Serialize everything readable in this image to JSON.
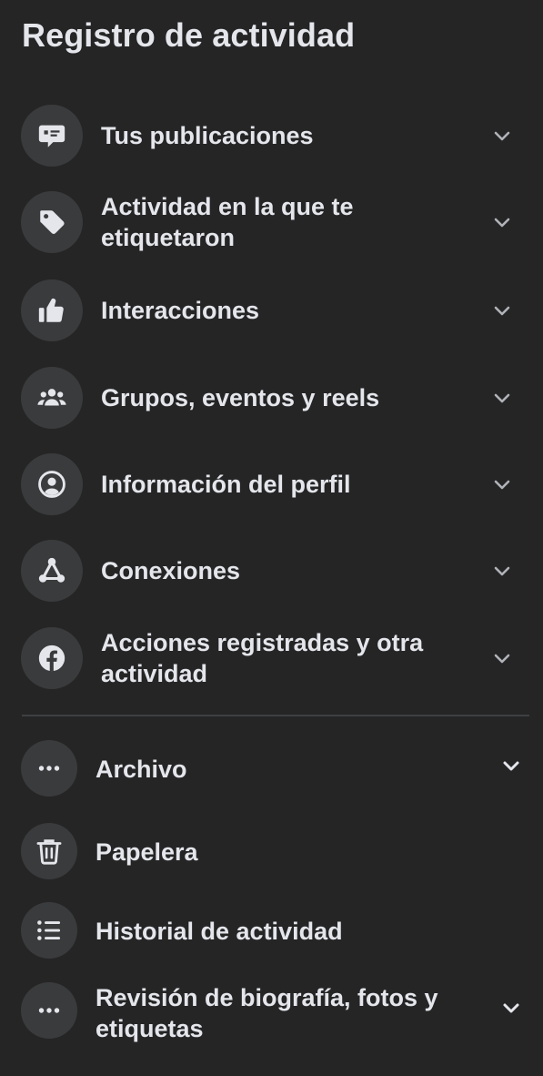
{
  "header": {
    "title": "Registro de actividad"
  },
  "sections": [
    {
      "label": "Tus publicaciones",
      "icon": "speech-bubble-icon"
    },
    {
      "label": "Actividad en la que te etiquetaron",
      "icon": "tag-icon"
    },
    {
      "label": "Interacciones",
      "icon": "thumbs-up-icon"
    },
    {
      "label": "Grupos, eventos y reels",
      "icon": "group-icon"
    },
    {
      "label": "Información del perfil",
      "icon": "profile-icon"
    },
    {
      "label": "Conexiones",
      "icon": "network-icon"
    },
    {
      "label": "Acciones registradas y otra actividad",
      "icon": "facebook-icon"
    }
  ],
  "tools": [
    {
      "label": "Archivo",
      "icon": "more-icon"
    },
    {
      "label": "Papelera",
      "icon": "trash-icon"
    },
    {
      "label": "Historial de actividad",
      "icon": "list-icon"
    },
    {
      "label": "Revisión de biografía, fotos y etiquetas",
      "icon": "more-icon"
    }
  ],
  "colors": {
    "background": "#252526",
    "icon_circle": "#3a3b3c",
    "text": "#e4e6eb",
    "divider": "#3e4042"
  }
}
